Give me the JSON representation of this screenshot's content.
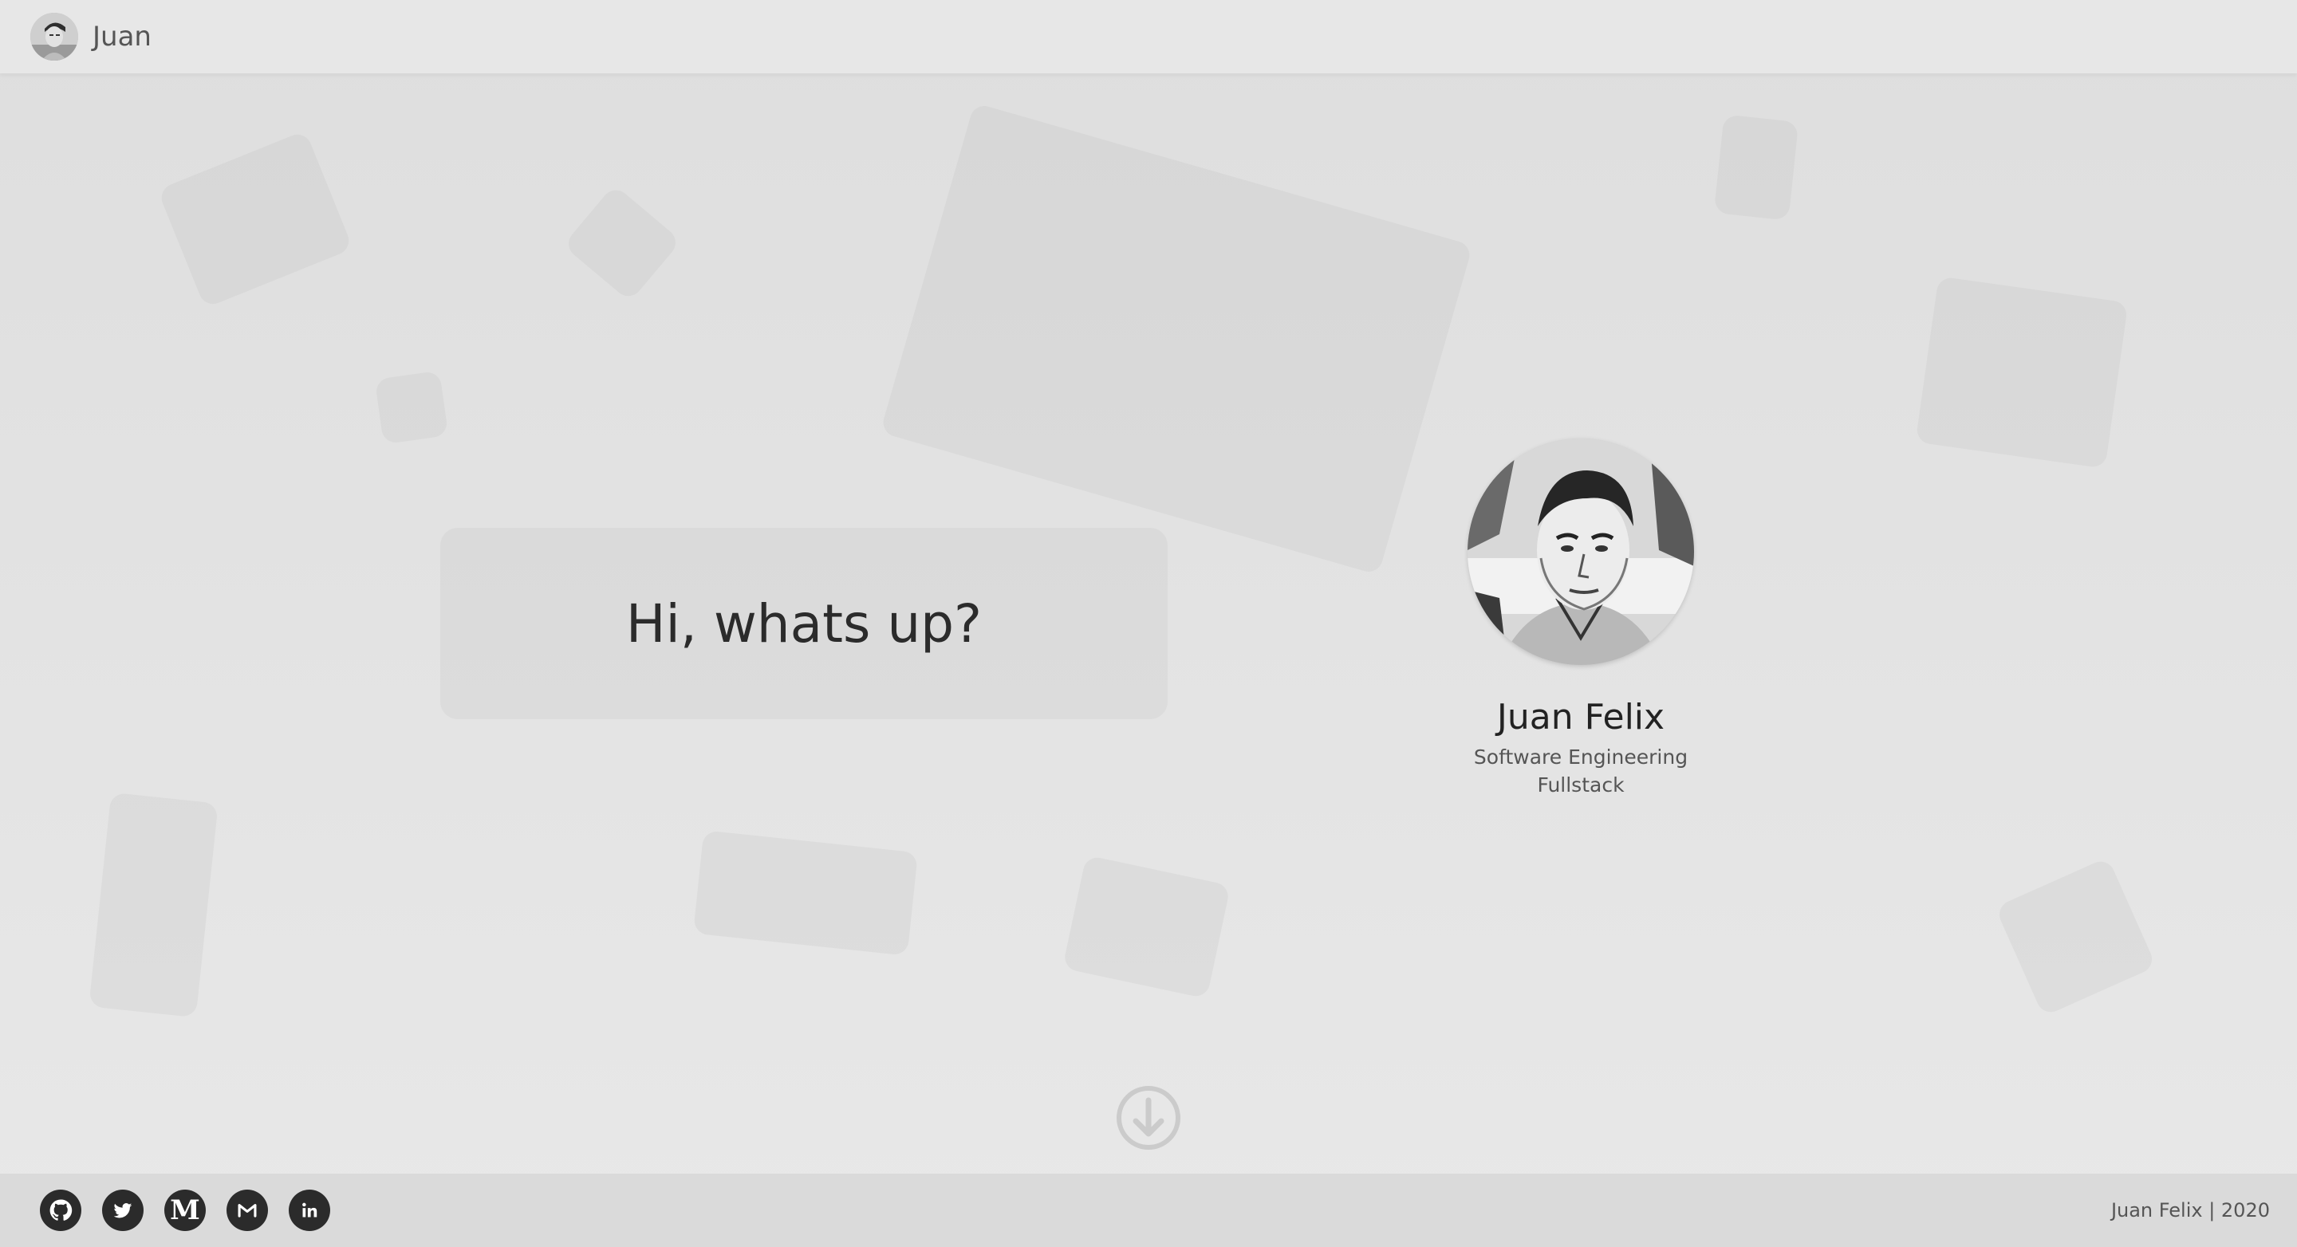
{
  "header": {
    "brand_name": "Juan",
    "avatar_icon": "avatar-photo"
  },
  "hero": {
    "greeting": "Hi, whats up?"
  },
  "profile": {
    "name": "Juan Felix",
    "role_line1": "Software Engineering",
    "role_line2": "Fullstack"
  },
  "scroll": {
    "icon": "arrow-down-circle-icon"
  },
  "footer": {
    "copyright": "Juan Felix | 2020",
    "social_links": [
      "github-icon",
      "twitter-icon",
      "medium-icon",
      "gmail-icon",
      "linkedin-icon"
    ]
  },
  "colors": {
    "background": "#e3e3e3",
    "header_bg": "#e7e7e7",
    "footer_bg": "#dadada",
    "text_dark": "#2b2b2b",
    "icon_dark": "#2b2b2b"
  }
}
